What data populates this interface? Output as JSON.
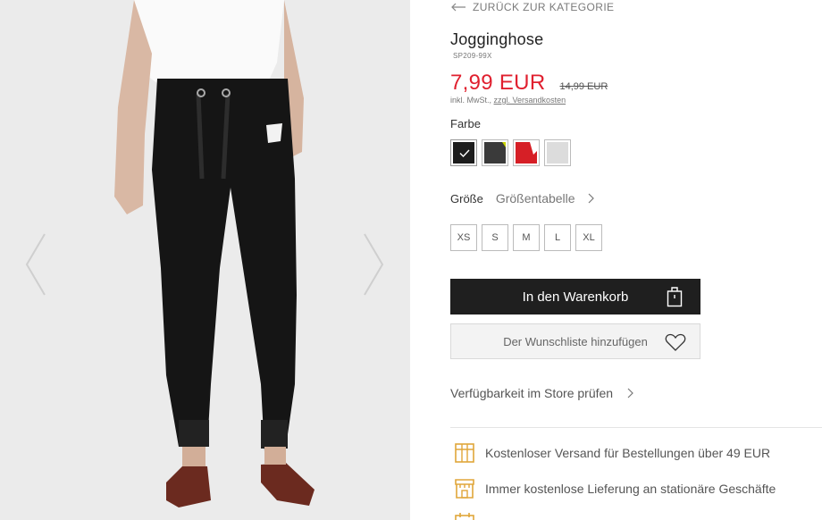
{
  "gallery": {
    "prev_icon": "chevron-left-icon",
    "next_icon": "chevron-right-icon"
  },
  "nav": {
    "back_label": "ZURÜCK ZUR KATEGORIE",
    "back_icon": "arrow-left-icon"
  },
  "product": {
    "title": "Jogginghose",
    "sku": "SP209-99X",
    "price": "7,99 EUR",
    "old_price": "14,99 EUR",
    "tax_note": "inkl. MwSt.,",
    "shipping_link": "zzgl. Versandkosten",
    "price_color": "#e0202f"
  },
  "color": {
    "label": "Farbe",
    "swatches": [
      {
        "name": "schwarz",
        "hex": "#1c1c1c",
        "selected": true
      },
      {
        "name": "dunkelgrau",
        "hex": "#3a3a3a",
        "selected": false
      },
      {
        "name": "rot",
        "hex": "#d61f26",
        "selected": false
      },
      {
        "name": "hellgrau",
        "hex": "#dcdcdc",
        "selected": false
      }
    ]
  },
  "size": {
    "label": "Größe",
    "chart_link": "Größentabelle",
    "options": [
      "XS",
      "S",
      "M",
      "L",
      "XL"
    ]
  },
  "actions": {
    "add_to_cart": "In den Warenkorb",
    "cart_icon": "shopping-bag-icon",
    "wishlist": "Der Wunschliste hinzufügen",
    "wishlist_icon": "heart-icon",
    "store_check": "Verfügbarkeit im Store prüfen"
  },
  "benefits": [
    {
      "icon": "box-icon",
      "text": "Kostenloser Versand für Bestellungen über 49 EUR"
    },
    {
      "icon": "store-icon",
      "text": "Immer kostenlose Lieferung an stationäre Geschäfte"
    },
    {
      "icon": "calendar-icon",
      "text": ""
    }
  ],
  "theme": {
    "accent": "#e0a63a",
    "button_dark": "#1f1f1f"
  }
}
